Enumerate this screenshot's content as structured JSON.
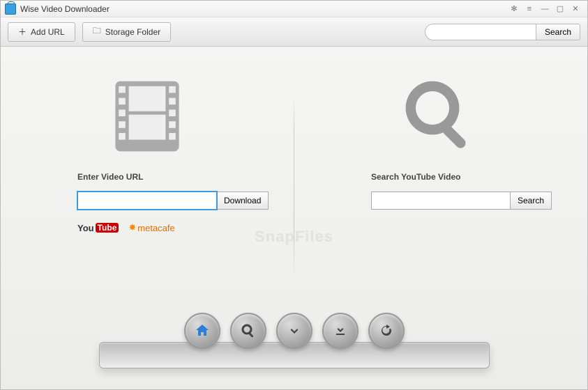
{
  "app": {
    "title": "Wise Video Downloader"
  },
  "toolbar": {
    "add_url": "Add URL",
    "storage_folder": "Storage Folder",
    "search_btn": "Search"
  },
  "left": {
    "label": "Enter Video URL",
    "button": "Download",
    "logos": {
      "youtube": "You",
      "youtube_tube": "Tube",
      "metacafe": "metacafe"
    }
  },
  "right": {
    "label": "Search YouTube Video",
    "button": "Search"
  },
  "dock": {
    "icons": [
      "home-icon",
      "search-icon",
      "download-icon",
      "download-queue-icon",
      "refresh-icon"
    ]
  },
  "watermark": "SnapFiles"
}
